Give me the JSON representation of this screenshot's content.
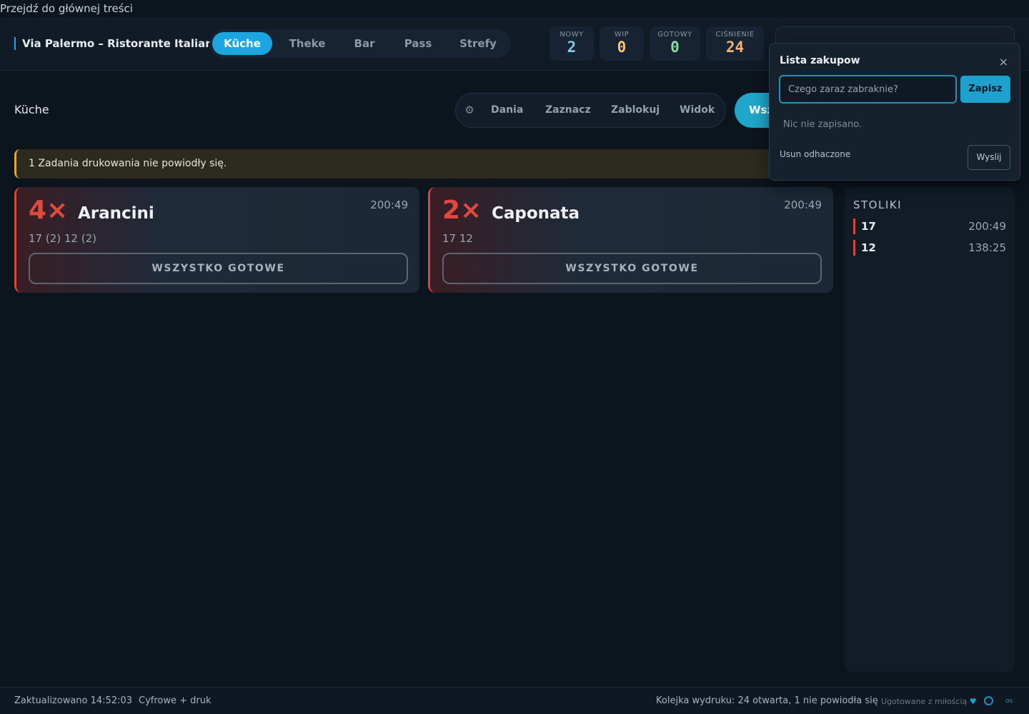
{
  "skip_link": "Przejdź do głównej treści",
  "header": {
    "brand": "Via Palermo – Ristorante Italiano",
    "stations": [
      "Küche",
      "Theke",
      "Bar",
      "Pass",
      "Strefy"
    ],
    "active_station": "Küche",
    "stats": [
      {
        "label": "NOWY",
        "value": "2",
        "color": "#7ec8f2"
      },
      {
        "label": "WIP",
        "value": "0",
        "color": "#f1c76b"
      },
      {
        "label": "GOTOWY",
        "value": "0",
        "color": "#8ad9a0"
      },
      {
        "label": "CIŚNIENIE",
        "value": "24",
        "color": "#f2b071"
      }
    ]
  },
  "toolbar": {
    "view_title": "Küche",
    "settings_icon": "gear-icon",
    "dishes": "Dania",
    "select": "Zaznacz",
    "block": "Zablokuj",
    "view": "Widok",
    "all_label": "Wsz"
  },
  "banner": "1 Zadania drukowania nie powiodły się.",
  "orders": [
    {
      "qty": "4×",
      "name": "Arancini",
      "timer": "200:49",
      "tables": "17 (2)  12 (2)",
      "action": "WSZYSTKO GOTOWE"
    },
    {
      "qty": "2×",
      "name": "Caponata",
      "timer": "200:49",
      "tables": "17  12",
      "action": "WSZYSTKO GOTOWE"
    }
  ],
  "tables_panel": {
    "title": "STOLIKI",
    "rows": [
      {
        "table": "17",
        "time": "200:49"
      },
      {
        "table": "12",
        "time": "138:25"
      }
    ]
  },
  "shopping_list": {
    "title": "Lista zakupow",
    "close": "×",
    "input_placeholder": "Czego zaraz zabraknie?",
    "input_value": "",
    "save": "Zapisz",
    "empty": "Nic nie zapisano.",
    "clear_checked": "Usun odhaczone",
    "send": "Wyslij"
  },
  "footer": {
    "updated": "Zaktualizowano 14:52:03",
    "mode": "Cyfrowe + druk",
    "queue": "Kolejka wydruku: 24 otwarta, 1 nie powiodła się",
    "love_text": "Ugotowane z miłością",
    "heart": "♥",
    "os": "os"
  },
  "colors": {
    "accent": "#1ca6e0",
    "danger": "#e04a3e",
    "warning": "#e0a73a"
  }
}
